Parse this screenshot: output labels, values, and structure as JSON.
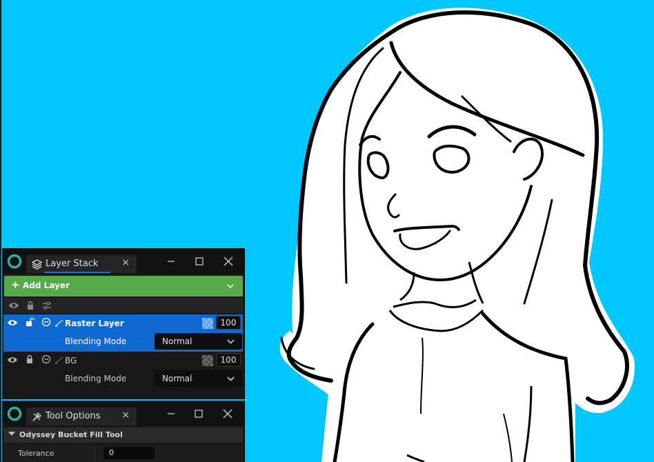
{
  "layer_stack_panel": {
    "tab_title": "Layer Stack",
    "add_layer_label": "Add Layer",
    "layers": [
      {
        "name": "Raster Layer",
        "opacity": "100",
        "blending_label": "Blending Mode",
        "blending_value": "Normal",
        "selected": true
      },
      {
        "name": "BG",
        "opacity": "100",
        "blending_label": "Blending Mode",
        "blending_value": "Normal",
        "selected": false
      }
    ]
  },
  "tool_options_panel": {
    "tab_title": "Tool Options",
    "section_title": "Odyssey Bucket Fill Tool",
    "tolerance_label": "Tolerance",
    "tolerance_value": "0"
  },
  "colors": {
    "canvas_background": "#00c8ff",
    "add_layer_button": "#58a94a",
    "selected_layer": "#0e6ad1",
    "panel_background": "#181818",
    "app_logo": "#26b5a9"
  },
  "icons": {
    "close": "close-icon",
    "minimize": "minimize-icon",
    "maximize": "maximize-icon",
    "visibility": "eye-icon",
    "lock": "lock-icon",
    "filter": "sliders-icon",
    "layer_stack": "layers-icon",
    "tool_options": "tools-icon"
  }
}
